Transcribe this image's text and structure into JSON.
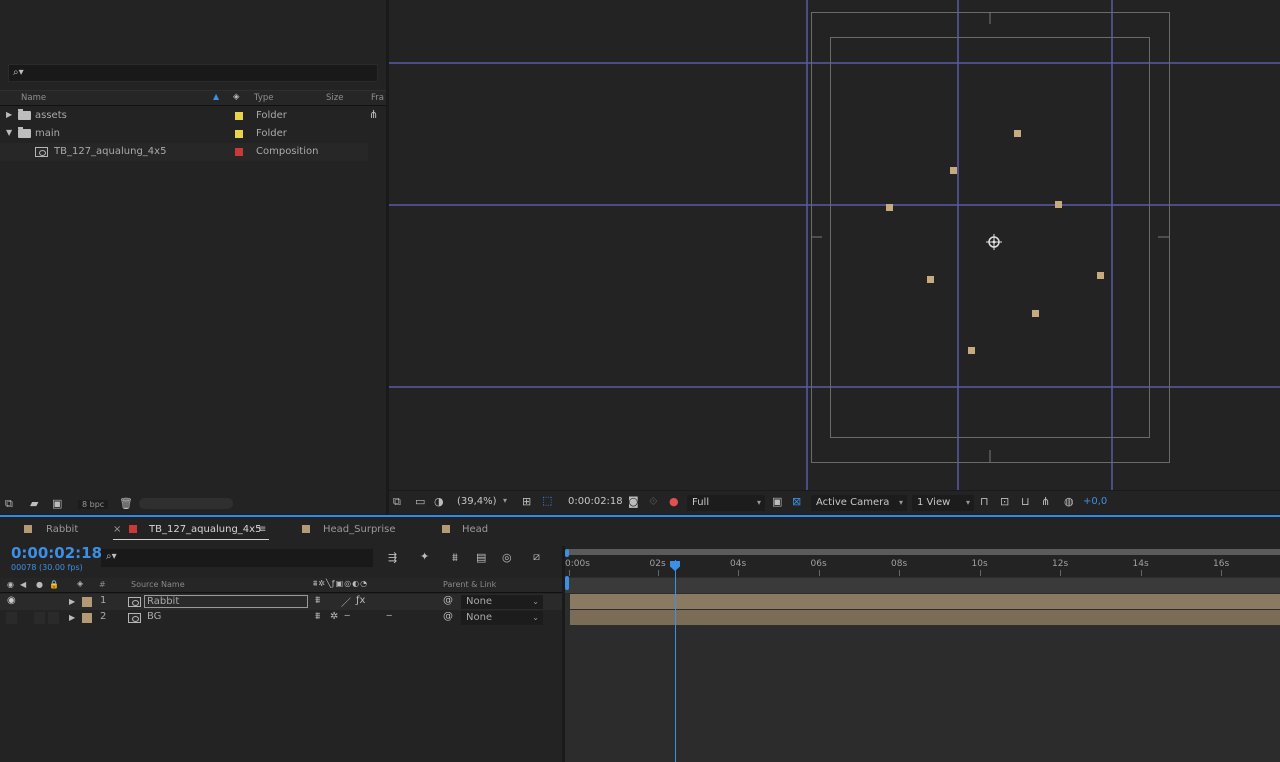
{
  "project": {
    "search_placeholder": "",
    "columns": {
      "name": "Name",
      "type": "Type",
      "size": "Size",
      "frame": "Fra"
    },
    "items": [
      {
        "name": "assets",
        "type": "Folder",
        "label_color": "#e8d44a",
        "expanded": false
      },
      {
        "name": "main",
        "type": "Folder",
        "label_color": "#e8d44a",
        "expanded": true
      },
      {
        "name": "TB_127_aqualung_4x5",
        "type": "Composition",
        "label_color": "#c83a3a"
      }
    ],
    "footer": {
      "bpc": "8 bpc"
    }
  },
  "viewer": {
    "zoom": "(39,4%)",
    "timecode": "0:00:02:18",
    "resolution": "Full",
    "camera": "Active Camera",
    "views": "1 View",
    "exposure": "+0,0",
    "guide_color": "#5a5aa8",
    "point_color": "#c8aa80"
  },
  "timeline": {
    "tabs": [
      {
        "label": "Rabbit",
        "color": "#b39a74"
      },
      {
        "label": "TB_127_aqualung_4x5",
        "color": "#c83a3a",
        "active": true
      },
      {
        "label": "Head_Surprise",
        "color": "#b39a74"
      },
      {
        "label": "Head",
        "color": "#b39a74"
      }
    ],
    "close_glyph": "×",
    "menu_glyph": "≡",
    "timecode": "0:00:02:18",
    "frame_info": "00078 (30.00 fps)",
    "columns": {
      "num": "#",
      "source": "Source Name",
      "parent": "Parent & Link"
    },
    "layers": [
      {
        "num": "1",
        "name": "Rabbit",
        "parent": "None",
        "color": "#b39a74"
      },
      {
        "num": "2",
        "name": "BG",
        "parent": "None",
        "color": "#b39a74"
      }
    ],
    "ruler": [
      "0:00s",
      "02s",
      "04s",
      "06s",
      "08s",
      "10s",
      "12s",
      "14s",
      "16s"
    ],
    "playhead_seconds": 2.6
  }
}
